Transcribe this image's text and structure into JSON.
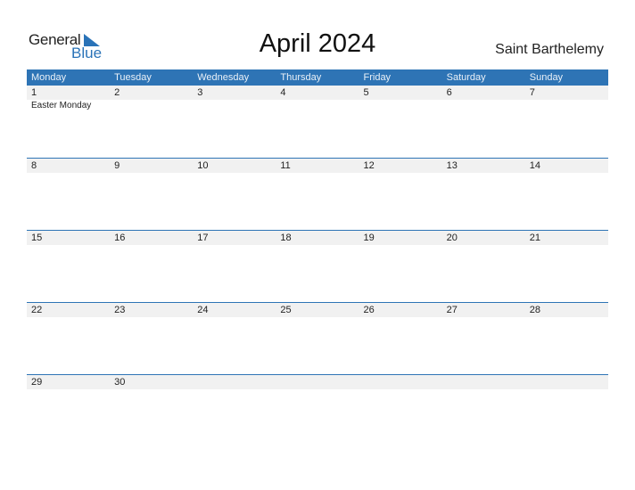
{
  "logo": {
    "general": "General",
    "blue": "Blue"
  },
  "header": {
    "title": "April 2024",
    "country": "Saint Barthelemy"
  },
  "days": [
    "Monday",
    "Tuesday",
    "Wednesday",
    "Thursday",
    "Friday",
    "Saturday",
    "Sunday"
  ],
  "weeks": [
    {
      "dates": [
        "1",
        "2",
        "3",
        "4",
        "5",
        "6",
        "7"
      ],
      "events": [
        "Easter Monday",
        "",
        "",
        "",
        "",
        "",
        ""
      ]
    },
    {
      "dates": [
        "8",
        "9",
        "10",
        "11",
        "12",
        "13",
        "14"
      ],
      "events": [
        "",
        "",
        "",
        "",
        "",
        "",
        ""
      ]
    },
    {
      "dates": [
        "15",
        "16",
        "17",
        "18",
        "19",
        "20",
        "21"
      ],
      "events": [
        "",
        "",
        "",
        "",
        "",
        "",
        ""
      ]
    },
    {
      "dates": [
        "22",
        "23",
        "24",
        "25",
        "26",
        "27",
        "28"
      ],
      "events": [
        "",
        "",
        "",
        "",
        "",
        "",
        ""
      ]
    },
    {
      "dates": [
        "29",
        "30",
        "",
        "",
        "",
        "",
        ""
      ],
      "events": [
        "",
        "",
        "",
        "",
        "",
        "",
        ""
      ]
    }
  ],
  "colors": {
    "accent": "#2e74b5",
    "row_bg": "#f1f1f1"
  }
}
